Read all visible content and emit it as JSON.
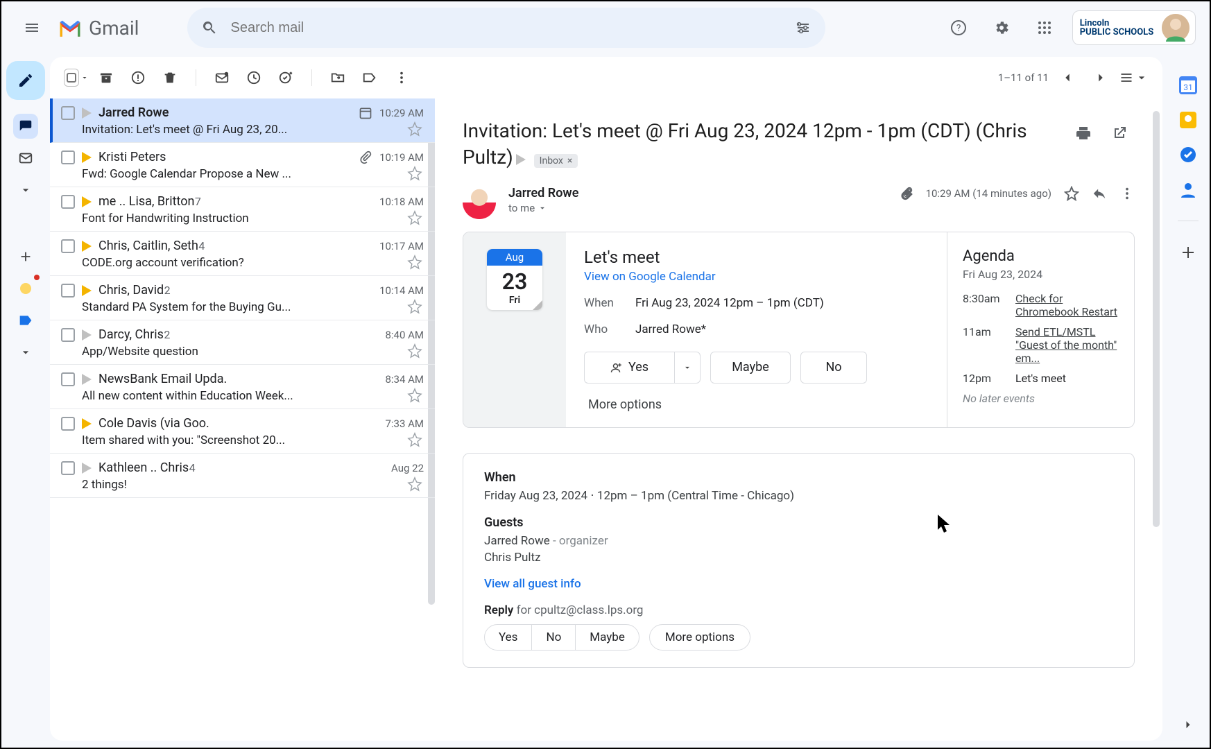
{
  "header": {
    "app_name": "Gmail",
    "search_placeholder": "Search mail",
    "org_name": "Lincoln\nPUBLIC SCHOOLS"
  },
  "toolbar": {
    "counter": "1–11 of 11"
  },
  "emails": [
    {
      "sender": "Jarred Rowe",
      "count": "",
      "subject": "Invitation: Let's meet @ Fri Aug 23, 20...",
      "time": "10:29 AM",
      "marker": "gray",
      "selected": true,
      "attach": false,
      "cal": true
    },
    {
      "sender": "Kristi Peters",
      "count": "",
      "subject": "Fwd: Google Calendar Propose a New ...",
      "time": "10:19 AM",
      "marker": "yellow",
      "selected": false,
      "attach": true,
      "cal": false
    },
    {
      "sender": "me .. Lisa, Britton",
      "count": "7",
      "subject": "Font for Handwriting Instruction",
      "time": "10:18 AM",
      "marker": "yellow",
      "selected": false,
      "attach": false,
      "cal": false
    },
    {
      "sender": "Chris, Caitlin, Seth",
      "count": "4",
      "subject": "CODE.org account verification?",
      "time": "10:17 AM",
      "marker": "yellow",
      "selected": false,
      "attach": false,
      "cal": false
    },
    {
      "sender": "Chris, David",
      "count": "2",
      "subject": "Standard PA System for the Buying Gu...",
      "time": "10:14 AM",
      "marker": "yellow",
      "selected": false,
      "attach": false,
      "cal": false
    },
    {
      "sender": "Darcy, Chris",
      "count": "2",
      "subject": "App/Website question",
      "time": "8:40 AM",
      "marker": "gray",
      "selected": false,
      "attach": false,
      "cal": false
    },
    {
      "sender": "NewsBank Email Upda.",
      "count": "",
      "subject": "All new content within Education Week...",
      "time": "8:34 AM",
      "marker": "gray",
      "selected": false,
      "attach": false,
      "cal": false
    },
    {
      "sender": "Cole Davis (via Goo.",
      "count": "",
      "subject": "Item shared with you: \"Screenshot 20...",
      "time": "7:33 AM",
      "marker": "yellow",
      "selected": false,
      "attach": false,
      "cal": false
    },
    {
      "sender": "Kathleen .. Chris",
      "count": "4",
      "subject": "2 things!",
      "time": "Aug 22",
      "marker": "gray",
      "selected": false,
      "attach": false,
      "cal": false
    }
  ],
  "message": {
    "title": "Invitation: Let's meet @ Fri Aug 23, 2024 12pm - 1pm (CDT) (Chris Pultz)",
    "label": "Inbox",
    "sender_name": "Jarred Rowe",
    "to_text": "to me",
    "timestamp": "10:29 AM (14 minutes ago)"
  },
  "invite": {
    "month": "Aug",
    "day": "23",
    "dow": "Fri",
    "title": "Let's meet",
    "view_link": "View on Google Calendar",
    "when_k": "When",
    "when_v": "Fri Aug 23, 2024 12pm – 1pm (CDT)",
    "who_k": "Who",
    "who_v": "Jarred Rowe*",
    "yes": "Yes",
    "maybe": "Maybe",
    "no": "No",
    "more": "More options"
  },
  "agenda": {
    "title": "Agenda",
    "date": "Fri Aug 23, 2024",
    "items": [
      {
        "t": "8:30am",
        "e": "Check for Chromebook Restart",
        "link": true
      },
      {
        "t": "11am",
        "e": "Send ETL/MSTL \"Guest of the month\" em...",
        "link": true
      },
      {
        "t": "12pm",
        "e": "Let's meet",
        "link": false
      }
    ],
    "no_later": "No later events"
  },
  "details": {
    "when_h": "When",
    "when_v": "Friday Aug 23, 2024 ⋅ 12pm – 1pm (Central Time - Chicago)",
    "guests_h": "Guests",
    "guest1": "Jarred Rowe",
    "guest1_role": " - organizer",
    "guest2": "Chris Pultz",
    "view_all": "View all guest info",
    "reply_label": "Reply",
    "reply_for": " for cpultz@class.lps.org",
    "yes": "Yes",
    "no": "No",
    "maybe": "Maybe",
    "more": "More options"
  }
}
